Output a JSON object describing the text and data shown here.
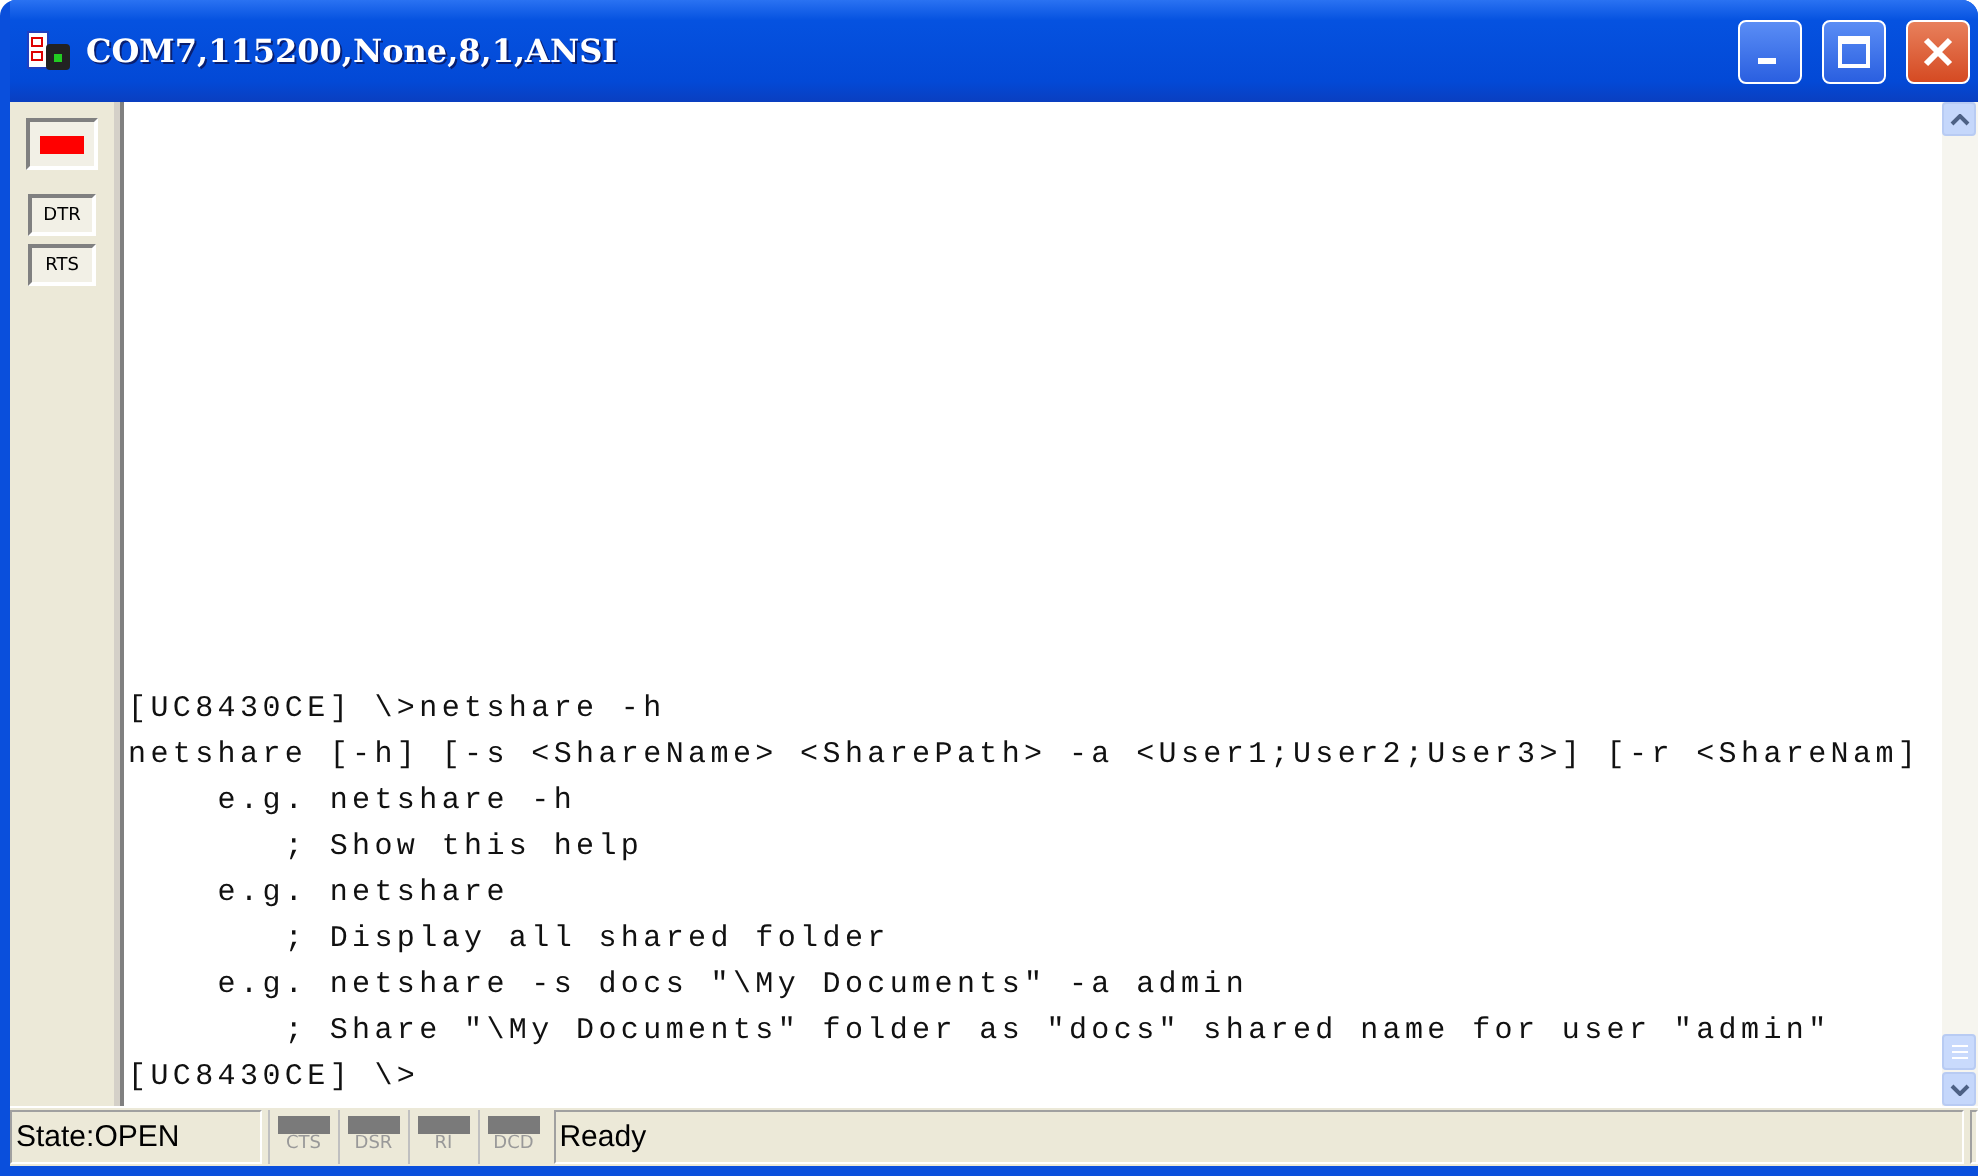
{
  "window": {
    "title": "COM7,115200,None,8,1,ANSI"
  },
  "side_indicators": [
    {
      "kind": "lamp",
      "on": true
    },
    {
      "kind": "label",
      "label": "DTR"
    },
    {
      "kind": "label",
      "label": "RTS"
    }
  ],
  "terminal": {
    "lines": [
      "[UC8430CE] \\>netshare -h",
      "netshare [-h] [-s <ShareName> <SharePath> -a <User1;User2;User3>] [-r <ShareNam]",
      "    e.g. netshare -h",
      "       ; Show this help",
      "    e.g. netshare",
      "       ; Display all shared folder",
      "    e.g. netshare -s docs \"\\My Documents\" -a admin",
      "       ; Share \"\\My Documents\" folder as \"docs\" shared name for user \"admin\"",
      "[UC8430CE] \\>"
    ]
  },
  "status_bar": {
    "state": "State:OPEN",
    "signals": [
      {
        "label": "CTS",
        "on": false
      },
      {
        "label": "DSR",
        "on": false
      },
      {
        "label": "RI",
        "on": false
      },
      {
        "label": "DCD",
        "on": false
      }
    ],
    "message": "Ready"
  }
}
